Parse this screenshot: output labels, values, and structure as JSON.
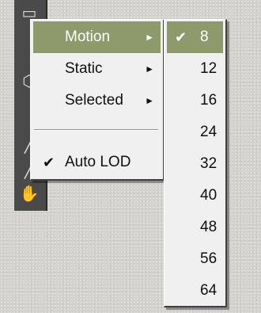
{
  "main_menu": {
    "items": [
      {
        "label": "Motion",
        "arrow": "►"
      },
      {
        "label": "Static",
        "arrow": "►"
      },
      {
        "label": "Selected",
        "arrow": "►"
      }
    ],
    "auto_lod": {
      "label": "Auto LOD",
      "check": "✔"
    }
  },
  "submenu": {
    "check": "✔",
    "items": [
      "8",
      "12",
      "16",
      "24",
      "32",
      "40",
      "48",
      "56",
      "64"
    ]
  },
  "colors": {
    "highlight": "#8e9a6c",
    "menu_bg": "#f0f0f0",
    "toolbar": "#4a4a4a"
  }
}
